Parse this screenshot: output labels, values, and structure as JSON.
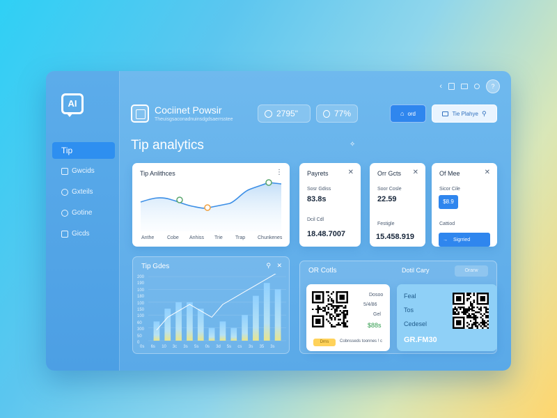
{
  "logo": {
    "text": "AI"
  },
  "sidebar": {
    "items": [
      {
        "label": "Tip",
        "active": true
      },
      {
        "label": "Gwcids"
      },
      {
        "label": "Gxteils"
      },
      {
        "label": "Gotine"
      },
      {
        "label": "Gicds"
      }
    ]
  },
  "topbar": {
    "avatar": "?"
  },
  "brand": {
    "title": "Cociinet Powsir",
    "subtitle": "Theuisgsaconadnuinsdgdsaerrsstee"
  },
  "stats": [
    {
      "value": "2795\""
    },
    {
      "value": "77%"
    }
  ],
  "buttons": {
    "primary": "ord",
    "secondary": "Tie Plahye"
  },
  "section": {
    "title": "Tip analytics",
    "sparkle": "✧"
  },
  "tip_chart": {
    "title": "Tip Anlithces",
    "menu": "⋮",
    "x_labels": [
      "Anthe",
      "Cobe",
      "Anhiss",
      "Trie",
      "Trap",
      "Chunkenes"
    ]
  },
  "payment_card": {
    "title": "Payrets",
    "close": "✕",
    "label1": "Sosr Gdiss",
    "value1": "83.8s",
    "label2": "Dcil Cdl",
    "value2": "18.48.7007"
  },
  "orders_card": {
    "title": "Orr Gcts",
    "close": "✕",
    "label1": "Soor Cosle",
    "value1": "22.59",
    "label2": "Festigle",
    "value2": "15.458.919"
  },
  "more_card": {
    "title": "Of Mee",
    "close": "✕",
    "label1": "Sicor Cile",
    "badge": "$8.9",
    "label2": "Cattiod",
    "button": "Sigrried"
  },
  "tip_codes": {
    "title": "Tip Gdes",
    "icons": [
      "⚲",
      "✕"
    ],
    "y_labels": [
      "200",
      "190",
      "100",
      "180",
      "100",
      "150",
      "100",
      "60",
      "300",
      "50",
      "0"
    ],
    "x_labels": [
      "0s",
      "6s",
      "10",
      "3c",
      "3s",
      "5s",
      "0s",
      "3d",
      "5s",
      "cs",
      "3s",
      "35",
      "3s"
    ]
  },
  "chart_data": {
    "type": "bar",
    "categories": [
      "1",
      "2",
      "3",
      "4",
      "5",
      "6",
      "7",
      "8",
      "9",
      "10",
      "11",
      "12"
    ],
    "series": [
      {
        "values": [
          3,
          5,
          6,
          6,
          5,
          2,
          3,
          2,
          4,
          7,
          9,
          8
        ]
      }
    ],
    "line": [
      1,
      3,
      4,
      5,
      4,
      3,
      5,
      6,
      7,
      8,
      9,
      10
    ],
    "ylim": [
      0,
      10
    ]
  },
  "qr_section": {
    "title": "OR Cotls",
    "right_title": "Dotil Cary",
    "right_button": "Orarw"
  },
  "qr_card1": {
    "lines": [
      "Dosoo",
      "5/4/86",
      "Gel",
      "$88s"
    ],
    "badge": "Drns",
    "footer": "Cobnsseds toonnes ! c"
  },
  "qr_card2": {
    "lines": [
      "Feal",
      "Tos",
      "Cedesel"
    ],
    "code": "GR.FM30"
  },
  "colors": {
    "accent": "#2f86ee",
    "window": "#5aa9e8",
    "card": "#ffffff"
  }
}
